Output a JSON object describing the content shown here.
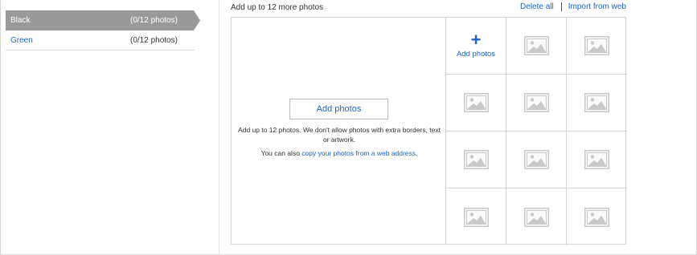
{
  "variations": [
    {
      "name": "Black",
      "count": "(0/12 photos)"
    },
    {
      "name": "Green",
      "count": "(0/12 photos)"
    }
  ],
  "header": {
    "title": "Add up to 12 more photos",
    "delete_all": "Delete all",
    "import_from_web": "Import from web"
  },
  "drop": {
    "add_button": "Add photos",
    "help": "Add up to 12 photos. We don't allow photos with extra borders, text or artwork.",
    "also_prefix": "You can also ",
    "also_link": "copy your photos from a web address",
    "also_suffix": "."
  },
  "grid": {
    "add_label": "Add photos",
    "add_icon": "plus-icon",
    "placeholder_icon": "image-placeholder-icon",
    "placeholders": 11
  },
  "colors": {
    "link": "#1f63c4",
    "active_row": "#999999",
    "border": "#d6d6d6",
    "placeholder": "#c9c9c9"
  }
}
